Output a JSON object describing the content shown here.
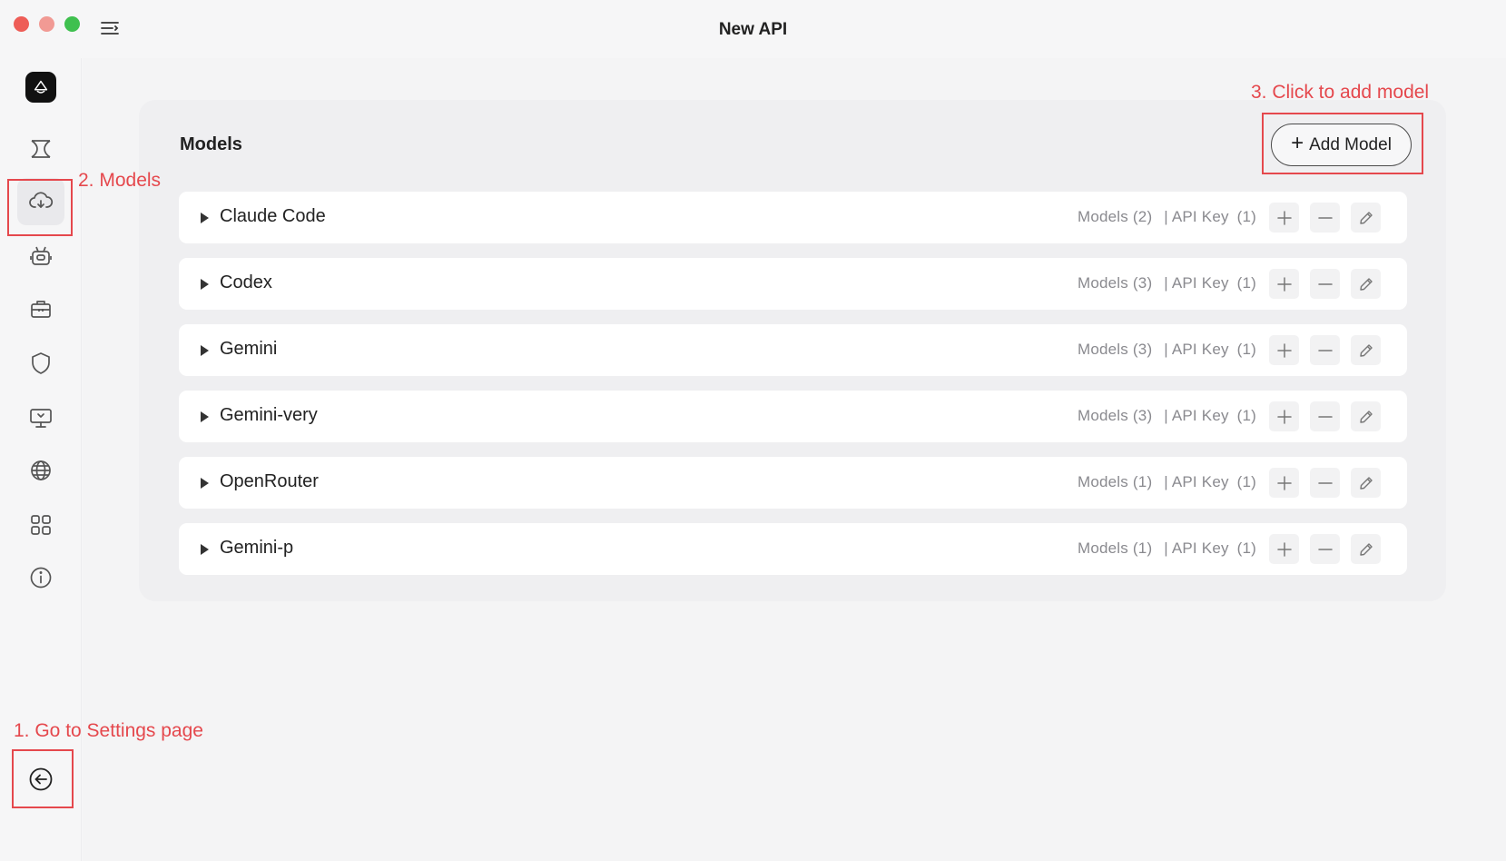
{
  "window": {
    "title": "New API"
  },
  "sidebar": {
    "items": [
      {
        "icon": "brand-logo-icon"
      },
      {
        "icon": "plugin-icon"
      },
      {
        "icon": "cloud-models-icon",
        "active": true
      },
      {
        "icon": "robot-icon"
      },
      {
        "icon": "toolbox-icon"
      },
      {
        "icon": "shield-icon"
      },
      {
        "icon": "monitor-icon"
      },
      {
        "icon": "globe-icon"
      },
      {
        "icon": "apps-grid-icon"
      },
      {
        "icon": "info-icon"
      },
      {
        "icon": "back-arrow-icon"
      }
    ]
  },
  "panel": {
    "title": "Models",
    "add_button_label": "Add Model",
    "providers": [
      {
        "name": "Claude Code",
        "models_label": "Models",
        "models_count": "(2)",
        "apikey_label": "| API Key",
        "apikey_count": "(1)"
      },
      {
        "name": "Codex",
        "models_label": "Models",
        "models_count": "(3)",
        "apikey_label": "| API Key",
        "apikey_count": "(1)"
      },
      {
        "name": "Gemini",
        "models_label": "Models",
        "models_count": "(3)",
        "apikey_label": "| API Key",
        "apikey_count": "(1)"
      },
      {
        "name": "Gemini-very",
        "models_label": "Models",
        "models_count": "(3)",
        "apikey_label": "| API Key",
        "apikey_count": "(1)"
      },
      {
        "name": "OpenRouter",
        "models_label": "Models",
        "models_count": "(1)",
        "apikey_label": "| API Key",
        "apikey_count": "(1)"
      },
      {
        "name": "Gemini-p",
        "models_label": "Models",
        "models_count": "(1)",
        "apikey_label": "| API Key",
        "apikey_count": "(1)"
      }
    ]
  },
  "annotations": {
    "step1": "1. Go to Settings page",
    "step2": "2. Models",
    "step3": "3. Click to add model"
  },
  "colors": {
    "annotation": "#e5484d"
  }
}
